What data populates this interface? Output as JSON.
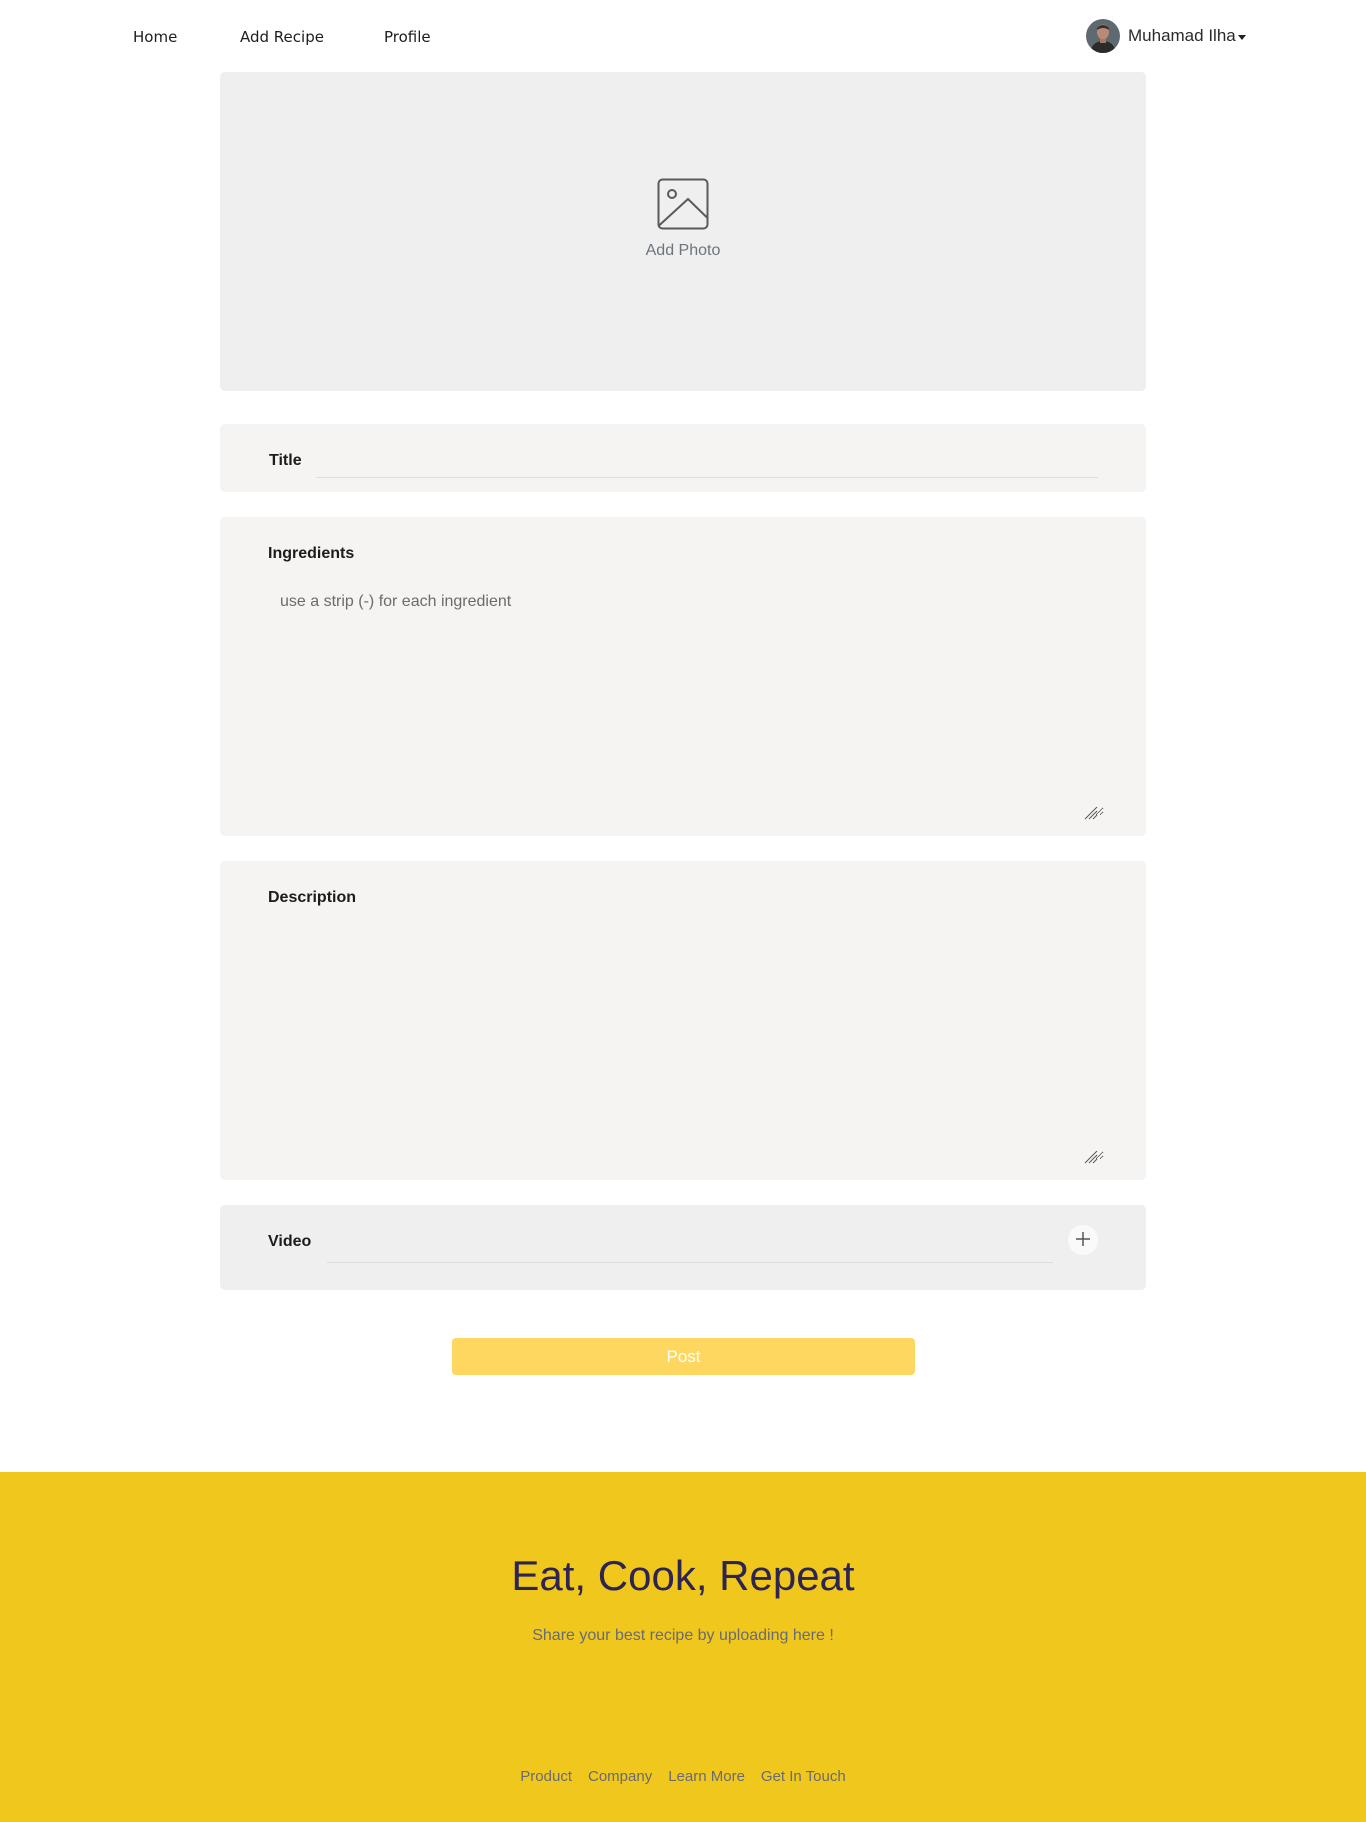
{
  "nav": {
    "home": "Home",
    "add_recipe": "Add Recipe",
    "profile": "Profile",
    "user_name": "Muhamad Ilha"
  },
  "form": {
    "photo_label": "Add Photo",
    "title_label": "Title",
    "title_value": "",
    "ingredients_label": "Ingredients",
    "ingredients_placeholder": "use a strip (-) for each ingredient",
    "description_label": "Description",
    "description_placeholder": "",
    "video_label": "Video",
    "video_value": "",
    "post_label": "Post"
  },
  "footer": {
    "title": "Eat, Cook, Repeat",
    "subtitle": "Share your best recipe by uploading here !",
    "links": [
      "Product",
      "Company",
      "Learn More",
      "Get In Touch"
    ]
  },
  "colors": {
    "footer_bg": "#f0c71c",
    "post_button": "#fdd75f",
    "footer_title": "#2e2452"
  }
}
